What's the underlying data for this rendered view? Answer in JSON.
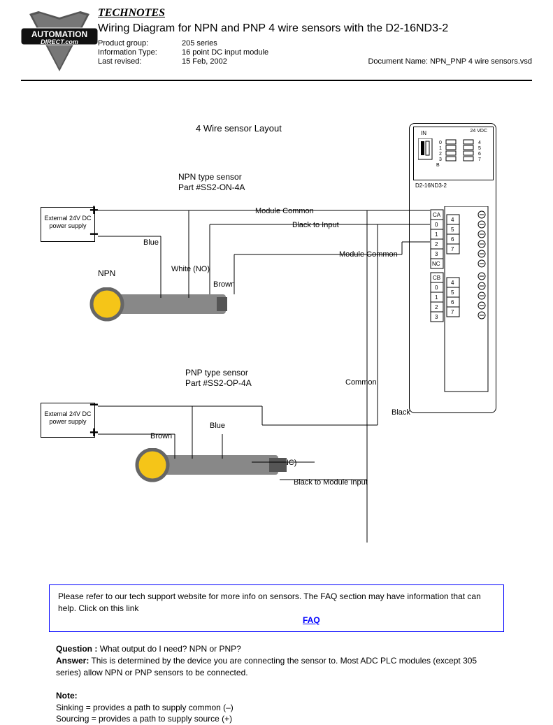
{
  "header": {
    "technotes": "TECHNOTES",
    "title": "Wiring Diagram for NPN and PNP 4 wire sensors with the D2-16ND3-2",
    "product_group_label": "Product group:",
    "product_group_value": "205 series",
    "info_type_label": "Information Type:",
    "info_type_value": "16 point DC input module",
    "last_revised_label": "Last revised:",
    "last_revised_value": "15 Feb, 2002",
    "doc_name": "Document Name: NPN_PNP 4 wire sensors.vsd",
    "logo_main": "AUTOMATION",
    "logo_sub": "DIRECT.com"
  },
  "diagram": {
    "layout_title": "4 Wire sensor Layout",
    "npn_title": "NPN type sensor",
    "npn_part": "Part #SS2-ON-4A",
    "pnp_title": "PNP type sensor",
    "pnp_part": "Part #SS2-OP-4A",
    "psu_text": "External 24V DC power supply",
    "module_label": "D2-16ND3-2",
    "module_in": "IN",
    "module_24vdc": "24 VDC",
    "wires": {
      "blue": "Blue",
      "brown": "Brown",
      "white_no": "White (NO)",
      "white_nc": "White (NC)",
      "black": "Black",
      "module_common": "Module Common",
      "black_to_input": "Black to Input",
      "common": "Common",
      "black_to_module_input": "Black to Module Input",
      "npn": "NPN"
    },
    "module_pins": {
      "A": "A",
      "B": "B",
      "0": "0",
      "1": "1",
      "2": "2",
      "3": "3",
      "4": "4",
      "5": "5",
      "6": "6",
      "7": "7",
      "CA": "CA",
      "CB": "CB",
      "NC": "NC"
    }
  },
  "faq_text1": "Please refer to our tech support website for more info on sensors.  The FAQ section may have information that can help.  Click on this link",
  "faq_link": "FAQ",
  "question_label": "Question :",
  "question_text": "What output do I need? NPN or PNP?",
  "answer_label": "Answer:",
  "answer_text": "This is determined by the device you are connecting the sensor to. Most ADC PLC modules (except 305 series) allow NPN or PNP sensors to be connected.",
  "note_label": "Note:",
  "note_line1": "Sinking = provides a path to supply common (–)",
  "note_line2": "Sourcing = provides a path to supply source (+)"
}
